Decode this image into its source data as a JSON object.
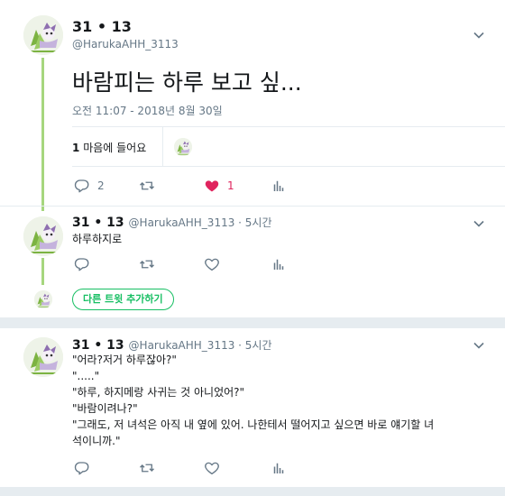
{
  "main_tweet": {
    "name": "31 • 13",
    "handle": "@HarukaAHH_3113",
    "text": "바람피는 하루 보고 싶...",
    "date": "오전 11:07 - 2018년 8월 30일",
    "likes_count": "1",
    "likes_label": "마음에 들어요",
    "reply_count": "2",
    "like_count": "1"
  },
  "reply1": {
    "name": "31 • 13",
    "handle_time": "@HarukaAHH_3113 · 5시간",
    "text": "하루하지로"
  },
  "add_tweet_label": "다른 트윗 추가하기",
  "reply2": {
    "name": "31 • 13",
    "handle_time": "@HarukaAHH_3113 · 5시간",
    "lines": [
      "\"어라?저거 하루잖아?\"",
      "\".....\"",
      "\"하루, 하지메랑 사귀는 것 아니었어?\"",
      "\"바람이려나?\"",
      "\"그래도, 저 녀석은 아직 내 옆에 있어. 나한테서 떨어지고 싶으면 바로 얘기할 녀",
      "석이니까.\""
    ]
  },
  "colors": {
    "thread_line": "#a6d67e",
    "like_active": "#e0245e",
    "add_tweet": "#17bf63"
  }
}
